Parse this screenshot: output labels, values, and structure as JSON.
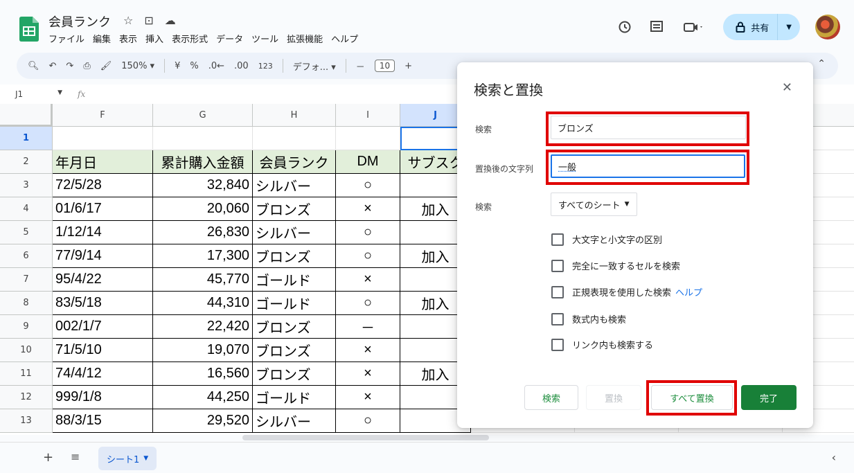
{
  "app": {
    "title": "会員ランク",
    "title_icons": [
      "☆",
      "⊡",
      "☁"
    ],
    "menu": [
      "ファイル",
      "編集",
      "表示",
      "挿入",
      "表示形式",
      "データ",
      "ツール",
      "拡張機能",
      "ヘルプ"
    ],
    "share_label": "共有",
    "colors": {
      "accent": "#0b57d0",
      "green": "#188038",
      "red": "#e00000",
      "header_fill": "#e2efda"
    }
  },
  "toolbar": {
    "zoom": "150%",
    "currency": "¥",
    "percent": "%",
    "dec_decrease": ".0←",
    "dec_increase": ".00",
    "number_format": "123",
    "font": "デフォ...",
    "minus": "－",
    "font_size": "10",
    "plus": "+"
  },
  "formula_bar": {
    "cell_ref": "J1",
    "fx": "fx"
  },
  "grid": {
    "columns": [
      "F",
      "G",
      "H",
      "I",
      "J"
    ],
    "selected_column": "J",
    "selected_row": "1",
    "row_numbers": [
      "1",
      "2",
      "3",
      "4",
      "5",
      "6",
      "7",
      "8",
      "9",
      "10",
      "11",
      "12",
      "13"
    ],
    "header_row": [
      "年月日",
      "累計購入金額",
      "会員ランク",
      "DM",
      "サブスク"
    ],
    "rows": [
      [
        "72/5/28",
        "32,840",
        "シルバー",
        "○",
        ""
      ],
      [
        "01/6/17",
        "20,060",
        "ブロンズ",
        "×",
        "加入"
      ],
      [
        "1/12/14",
        "26,830",
        "シルバー",
        "○",
        ""
      ],
      [
        "77/9/14",
        "17,300",
        "ブロンズ",
        "○",
        "加入"
      ],
      [
        "95/4/22",
        "45,770",
        "ゴールド",
        "×",
        ""
      ],
      [
        "83/5/18",
        "44,310",
        "ゴールド",
        "○",
        "加入"
      ],
      [
        "002/1/7",
        "22,420",
        "ブロンズ",
        "－",
        ""
      ],
      [
        "71/5/10",
        "19,070",
        "ブロンズ",
        "×",
        ""
      ],
      [
        "74/4/12",
        "16,560",
        "ブロンズ",
        "×",
        "加入"
      ],
      [
        "999/1/8",
        "44,250",
        "ゴールド",
        "×",
        ""
      ],
      [
        "88/3/15",
        "29,520",
        "シルバー",
        "○",
        ""
      ]
    ]
  },
  "sheetbar": {
    "add": "+",
    "list": "≡",
    "sheet_name": "シート1",
    "nav": "‹"
  },
  "dialog": {
    "title": "検索と置換",
    "find_label": "検索",
    "find_value": "ブロンズ",
    "replace_label": "置換後の文字列",
    "replace_value": "一般",
    "scope_label": "検索",
    "scope_value": "すべてのシート",
    "options": [
      {
        "label": "大文字と小文字の区別",
        "link": ""
      },
      {
        "label": "完全に一致するセルを検索",
        "link": ""
      },
      {
        "label": "正規表現を使用した検索",
        "link": "ヘルプ"
      },
      {
        "label": "数式内も検索",
        "link": ""
      },
      {
        "label": "リンク内も検索する",
        "link": ""
      }
    ],
    "buttons": {
      "find": "検索",
      "replace": "置換",
      "replace_all": "すべて置換",
      "done": "完了"
    }
  }
}
